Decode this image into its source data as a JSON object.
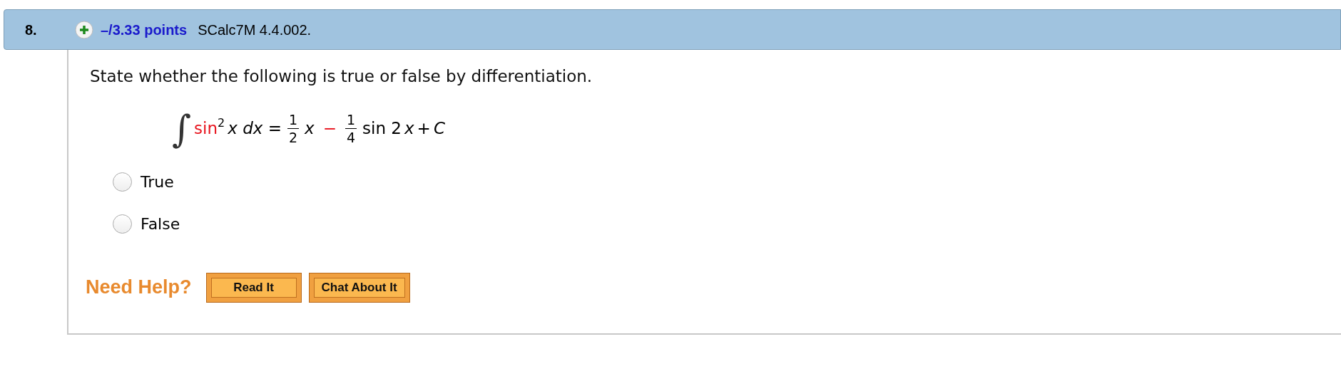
{
  "header": {
    "number": "8.",
    "points": "–/3.33 points",
    "source": "SCalc7M 4.4.002."
  },
  "question": "State whether the following is true or false by differentiation.",
  "formula": [
    {
      "kind": "integral",
      "text": "∫"
    },
    {
      "kind": "func",
      "text": "sin"
    },
    {
      "kind": "sup",
      "text": "2"
    },
    {
      "kind": "text",
      "text": "*x* *dx* ="
    },
    {
      "kind": "frac",
      "num": "1",
      "den": "2"
    },
    {
      "kind": "text",
      "text": "*x*"
    },
    {
      "kind": "op",
      "text": "−"
    },
    {
      "kind": "frac",
      "num": "1",
      "den": "4"
    },
    {
      "kind": "text",
      "text": "sin 2"
    },
    {
      "kind": "var",
      "text": "x"
    },
    {
      "kind": "text",
      "text": "+"
    },
    {
      "kind": "var",
      "text": "C"
    }
  ],
  "options": [
    {
      "label": "True",
      "selected": false
    },
    {
      "label": "False",
      "selected": false
    }
  ],
  "help": {
    "label": "Need Help?",
    "buttons": [
      "Read It",
      "Chat About It"
    ]
  }
}
